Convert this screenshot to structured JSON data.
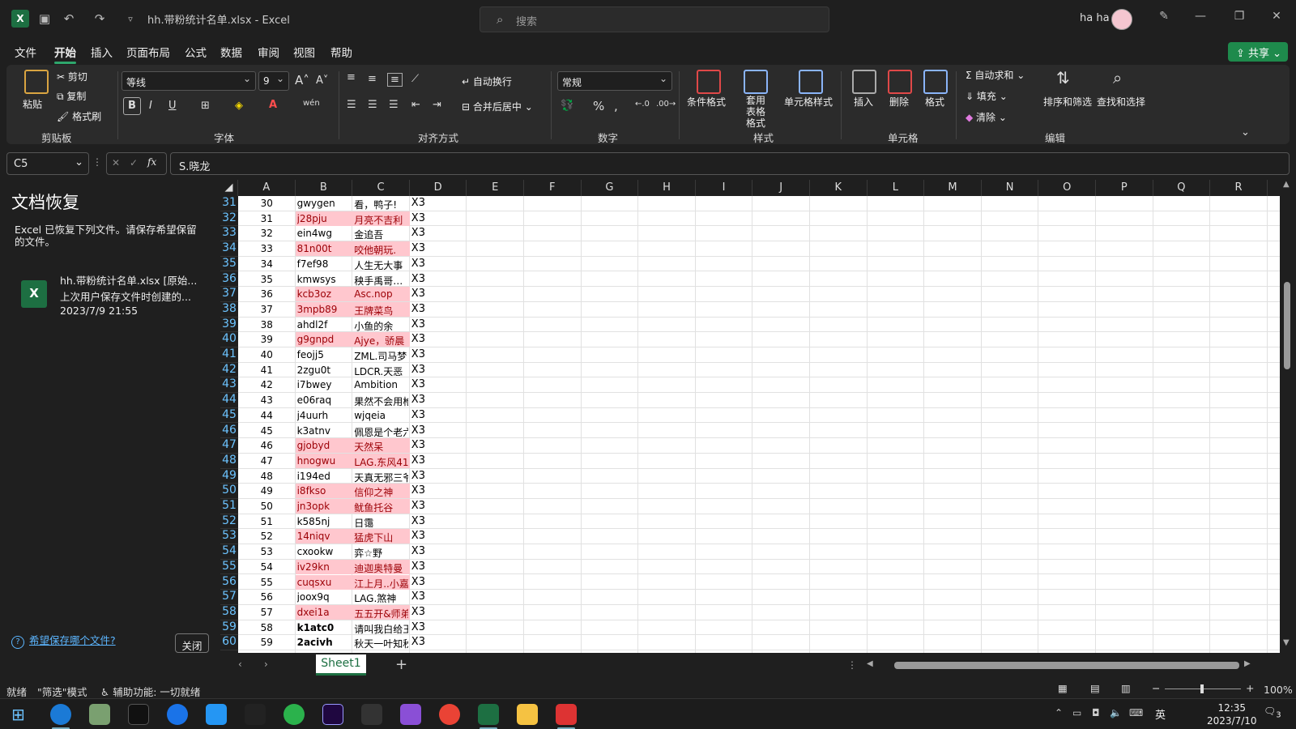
{
  "titlebar": {
    "doc_title": "hh.带粉统计名单.xlsx  -  Excel",
    "search_placeholder": "搜索",
    "user_name": "ha ha"
  },
  "menu": [
    "文件",
    "开始",
    "插入",
    "页面布局",
    "公式",
    "数据",
    "审阅",
    "视图",
    "帮助"
  ],
  "menu_active": "开始",
  "share_label": "共享",
  "ribbon": {
    "clipboard": {
      "paste": "粘贴",
      "cut": "剪切",
      "copy": "复制",
      "format_painter": "格式刷",
      "label": "剪贴板"
    },
    "font": {
      "name": "等线",
      "size": "9",
      "bold": "B",
      "italic": "I",
      "underline": "U",
      "label": "字体"
    },
    "alignment": {
      "wrap": "自动换行",
      "merge": "合并后居中",
      "label": "对齐方式"
    },
    "number": {
      "format": "常规",
      "label": "数字"
    },
    "styles": {
      "conditional": "条件格式",
      "table": "套用 表格格式",
      "cell": "单元格样式",
      "label": "样式"
    },
    "cells": {
      "insert": "插入",
      "delete": "删除",
      "format": "格式",
      "label": "单元格"
    },
    "editing": {
      "autosum": "自动求和",
      "fill": "填充",
      "clear": "清除",
      "sort": "排序和筛选",
      "find": "查找和选择",
      "label": "编辑"
    }
  },
  "formula_bar": {
    "name_box": "C5",
    "formula": "S.晓龙",
    "fx": "fx"
  },
  "recovery": {
    "title": "文档恢复",
    "message": "Excel 已恢复下列文件。请保存希望保留的文件。",
    "file_name": "hh.带粉统计名单.xlsx  [原始...",
    "file_desc": "上次用户保存文件时创建的...",
    "file_time": "2023/7/9 21:55",
    "help_link": "希望保存哪个文件?",
    "close": "关闭"
  },
  "columns": [
    "A",
    "B",
    "C",
    "D",
    "E",
    "F",
    "G",
    "H",
    "I",
    "J",
    "K",
    "L",
    "M",
    "N",
    "O",
    "P",
    "Q",
    "R"
  ],
  "rows": [
    {
      "r": "31",
      "a": "30",
      "b": "gwygen",
      "c": "看，鸭子!",
      "d": "X3",
      "pink": false
    },
    {
      "r": "32",
      "a": "31",
      "b": "j28pju",
      "c": "月亮不吉利",
      "d": "X3",
      "pink": true
    },
    {
      "r": "33",
      "a": "32",
      "b": "ein4wg",
      "c": "金追吾",
      "d": "X3",
      "pink": false
    },
    {
      "r": "34",
      "a": "33",
      "b": "81n00t",
      "c": "咬他朝玩.",
      "d": "X3",
      "pink": true
    },
    {
      "r": "35",
      "a": "34",
      "b": "f7ef98",
      "c": "人生无大事",
      "d": "X3",
      "pink": false
    },
    {
      "r": "36",
      "a": "35",
      "b": "kmwsys",
      "c": "秧手禹哥…",
      "d": "X3",
      "pink": false
    },
    {
      "r": "37",
      "a": "36",
      "b": "kcb3oz",
      "c": "Asc.nop",
      "d": "X3",
      "pink": true
    },
    {
      "r": "38",
      "a": "37",
      "b": "3mpb89",
      "c": "王牌菜鸟",
      "d": "X3",
      "pink": true
    },
    {
      "r": "39",
      "a": "38",
      "b": "ahdl2f",
      "c": "小鱼的余",
      "d": "X3",
      "pink": false
    },
    {
      "r": "40",
      "a": "39",
      "b": "g9gnpd",
      "c": "Ajye，骄晨",
      "d": "X3",
      "pink": true
    },
    {
      "r": "41",
      "a": "40",
      "b": "feojj5",
      "c": "ZML.司马梦",
      "d": "X3",
      "pink": false
    },
    {
      "r": "42",
      "a": "41",
      "b": "2zgu0t",
      "c": "LDCR.天恶",
      "d": "X3",
      "pink": false
    },
    {
      "r": "43",
      "a": "42",
      "b": "i7bwey",
      "c": "Ambition",
      "d": "X3",
      "pink": false
    },
    {
      "r": "44",
      "a": "43",
      "b": "e06raq",
      "c": "果然不会用枪",
      "d": "X3",
      "pink": false
    },
    {
      "r": "45",
      "a": "44",
      "b": "j4uurh",
      "c": "wjqeia",
      "d": "X3",
      "pink": false
    },
    {
      "r": "46",
      "a": "45",
      "b": "k3atnv",
      "c": "佩恩是个老六",
      "d": "X3",
      "pink": false
    },
    {
      "r": "47",
      "a": "46",
      "b": "gjobyd",
      "c": "天然呆",
      "d": "X3",
      "pink": true
    },
    {
      "r": "48",
      "a": "47",
      "b": "hnogwu",
      "c": "LAG.东风41",
      "d": "X3",
      "pink": true
    },
    {
      "r": "49",
      "a": "48",
      "b": "i194ed",
      "c": "天真无邪三爷",
      "d": "X3",
      "pink": false
    },
    {
      "r": "50",
      "a": "49",
      "b": "i8fkso",
      "c": "信仰之神",
      "d": "X3",
      "pink": true
    },
    {
      "r": "51",
      "a": "50",
      "b": "jn3opk",
      "c": "鱿鱼托谷",
      "d": "X3",
      "pink": true
    },
    {
      "r": "52",
      "a": "51",
      "b": "k585nj",
      "c": "日霭",
      "d": "X3",
      "pink": false
    },
    {
      "r": "53",
      "a": "52",
      "b": "14niqv",
      "c": "猛虎下山",
      "d": "X3",
      "pink": true
    },
    {
      "r": "54",
      "a": "53",
      "b": "cxookw",
      "c": "弈☆野",
      "d": "X3",
      "pink": false
    },
    {
      "r": "55",
      "a": "54",
      "b": "iv29kn",
      "c": "迪迦奥特曼",
      "d": "X3",
      "pink": true
    },
    {
      "r": "56",
      "a": "55",
      "b": "cuqsxu",
      "c": "江上月..小嘉",
      "d": "X3",
      "pink": true
    },
    {
      "r": "57",
      "a": "56",
      "b": "joox9q",
      "c": "LAG.煞神",
      "d": "X3",
      "pink": false
    },
    {
      "r": "58",
      "a": "57",
      "b": "dxei1a",
      "c": "五五开&师弟",
      "d": "X3",
      "pink": true
    },
    {
      "r": "59",
      "a": "58",
      "b": "k1atc0",
      "c": "请叫我白给王",
      "d": "X3",
      "pink": false
    },
    {
      "r": "60",
      "a": "59",
      "b": "2acivh",
      "c": "秋天一叶知秋",
      "d": "X3",
      "pink": false
    }
  ],
  "sheet_tab": "Sheet1",
  "status": {
    "ready": "就绪",
    "filter_mode": "\"筛选\"模式",
    "accessibility": "辅助功能: 一切就绪",
    "zoom": "100%"
  },
  "taskbar": {
    "time": "12:35",
    "date": "2023/7/10",
    "ime": "英",
    "notifications": "3"
  }
}
